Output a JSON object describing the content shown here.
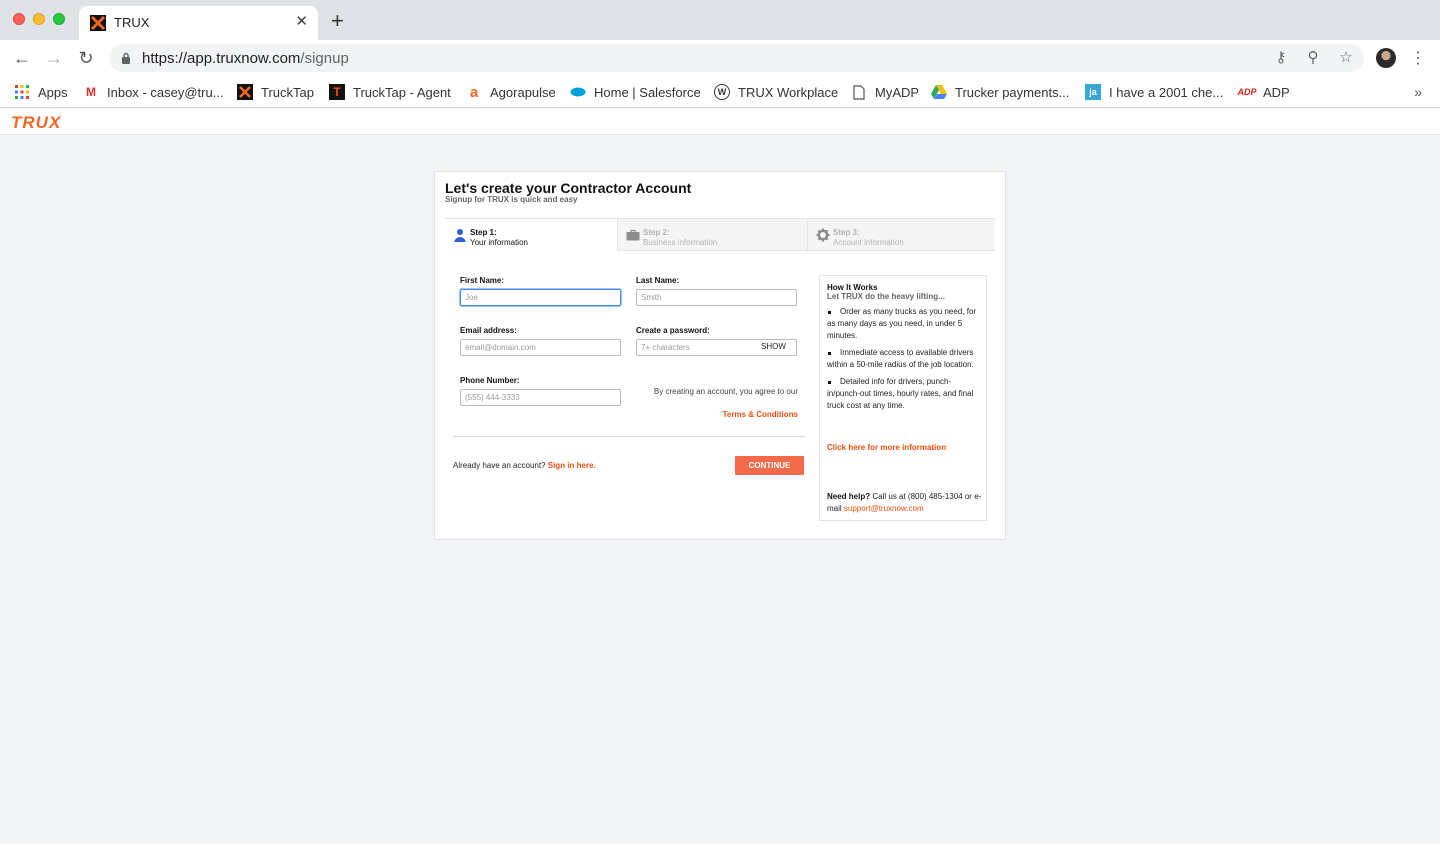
{
  "browser": {
    "tab_title": "TRUX",
    "tab_close": "✕",
    "new_tab": "+",
    "url_host": "https://app.truxnow.com",
    "url_path": "/signup",
    "bookmarks": [
      {
        "label": "Apps",
        "icon": "apps-grid-icon"
      },
      {
        "label": "Inbox - casey@tru...",
        "icon": "gmail-icon"
      },
      {
        "label": "TruckTap",
        "icon": "trux-icon"
      },
      {
        "label": "TruckTap - Agent",
        "icon": "trucktap-icon"
      },
      {
        "label": "Agorapulse",
        "icon": "agorapulse-icon"
      },
      {
        "label": "Home | Salesforce",
        "icon": "salesforce-icon"
      },
      {
        "label": "TRUX Workplace",
        "icon": "workplace-icon"
      },
      {
        "label": "MyADP",
        "icon": "document-icon"
      },
      {
        "label": "Trucker payments...",
        "icon": "google-drive-icon"
      },
      {
        "label": "I have a 2001 che...",
        "icon": "justanswer-icon"
      },
      {
        "label": "ADP",
        "icon": "adp-icon"
      }
    ],
    "bookmarks_more": "»"
  },
  "app": {
    "logo": "TRUX",
    "brand_color": "#f06623"
  },
  "signup": {
    "title": "Let's create your Contractor Account",
    "subtitle": "Signup for TRUX is quick and easy",
    "steps": [
      {
        "number": "Step 1:",
        "label": "Your information",
        "active": true,
        "icon": "user-icon"
      },
      {
        "number": "Step 2:",
        "label": "Business information",
        "active": false,
        "icon": "briefcase-icon"
      },
      {
        "number": "Step 3:",
        "label": "Account information",
        "active": false,
        "icon": "gear-icon"
      }
    ],
    "fields": {
      "first_name": {
        "label": "First Name:",
        "placeholder": "Joe",
        "value": ""
      },
      "last_name": {
        "label": "Last Name:",
        "placeholder": "Smith",
        "value": ""
      },
      "email": {
        "label": "Email address:",
        "placeholder": "email@domain.com",
        "value": ""
      },
      "password": {
        "label": "Create a password:",
        "placeholder": "7+ characters",
        "value": "",
        "show_label": "SHOW"
      },
      "phone": {
        "label": "Phone Number:",
        "placeholder": "(555) 444-3333",
        "value": ""
      }
    },
    "agree_text": "By creating an account, you agree to our",
    "terms_link": "Terms & Conditions",
    "already_text": "Already have an account?",
    "signin_link": "Sign in here.",
    "continue_label": "CONTINUE"
  },
  "how_it_works": {
    "title": "How It Works",
    "subtitle": "Let TRUX do the heavy lifting...",
    "items": [
      "Order as many trucks as you need, for as many days as you need, in under 5 minutes.",
      "Immediate access to available drivers within a 50-mile radius of the job location.",
      "Detailed info for drivers, punch-in/punch-out times, hourly rates, and final truck cost at any time."
    ],
    "more_link": "Click here for more information",
    "help_label": "Need help?",
    "help_text": "Call us at (800) 485-1304 or e-mail",
    "help_email": "support@truxnow.com"
  }
}
